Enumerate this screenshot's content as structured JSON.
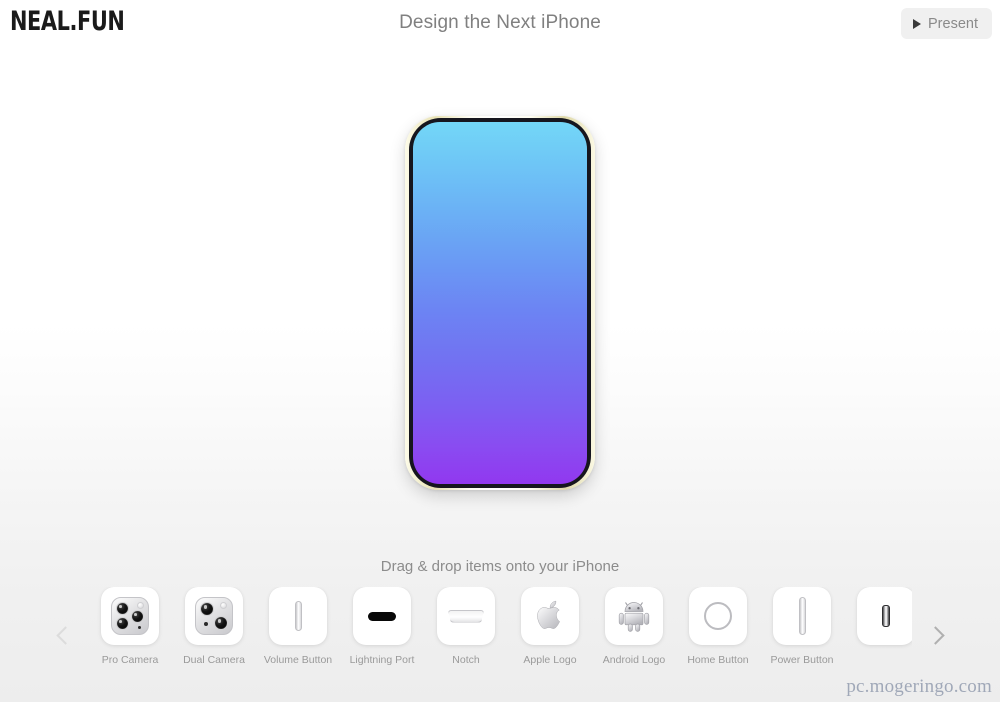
{
  "header": {
    "brand": "NEAL.FUN",
    "title": "Design the Next iPhone",
    "present_label": "Present",
    "present_icon": "play-triangle-icon"
  },
  "phone": {
    "frame_color": "#16161e",
    "band_color": "#e8e2b4",
    "screen_gradient_top": "#73d7f7",
    "screen_gradient_mid": "#6c84f3",
    "screen_gradient_bottom": "#9138ef",
    "placed_items": []
  },
  "tray": {
    "hint": "Drag & drop items onto your iPhone",
    "prev_arrow": "chevron-left-icon",
    "next_arrow": "chevron-right-icon",
    "items": [
      {
        "label": "Pro Camera",
        "icon": "pro-camera-icon"
      },
      {
        "label": "Dual Camera",
        "icon": "dual-camera-icon"
      },
      {
        "label": "Volume Button",
        "icon": "volume-button-icon"
      },
      {
        "label": "Lightning Port",
        "icon": "lightning-port-icon"
      },
      {
        "label": "Notch",
        "icon": "notch-icon"
      },
      {
        "label": "Apple Logo",
        "icon": "apple-logo-icon"
      },
      {
        "label": "Android Logo",
        "icon": "android-logo-icon"
      },
      {
        "label": "Home Button",
        "icon": "home-button-icon"
      },
      {
        "label": "Power Button",
        "icon": "power-button-icon"
      },
      {
        "label": "",
        "icon": "power-button-dark-icon"
      }
    ]
  },
  "watermark": {
    "text": "pc.mogeringo.com"
  },
  "colors": {
    "background_top": "#ffffff",
    "background_bottom": "#ededed",
    "text_muted": "#8c8c8c",
    "tile_background": "#ffffff"
  }
}
